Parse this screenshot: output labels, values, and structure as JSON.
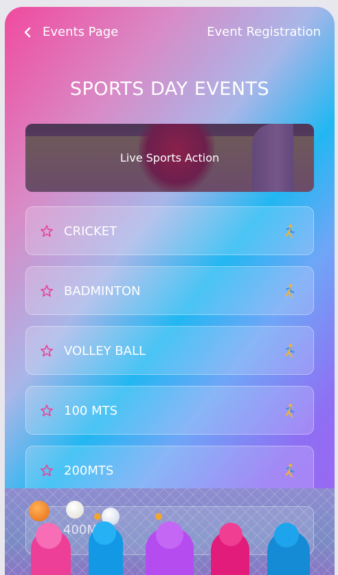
{
  "header": {
    "back_label": "Events Page",
    "registration_label": "Event Registration"
  },
  "title": "SPORTS DAY EVENTS",
  "banner": {
    "caption": "Live Sports Action"
  },
  "events": [
    {
      "label": "CRICKET",
      "icon": "runner-icon"
    },
    {
      "label": "BADMINTON",
      "icon": "runner-icon"
    },
    {
      "label": "VOLLEY BALL",
      "icon": "runner-icon"
    },
    {
      "label": "100 MTS",
      "icon": "runner-icon"
    },
    {
      "label": "200MTS",
      "icon": "runner-icon"
    },
    {
      "label": "400M",
      "icon": "runner-icon"
    }
  ],
  "colors": {
    "accent_pink": "#f04a9e",
    "accent_blue": "#22b7f2",
    "accent_purple": "#a062f2",
    "star_color": "#e8479b"
  }
}
